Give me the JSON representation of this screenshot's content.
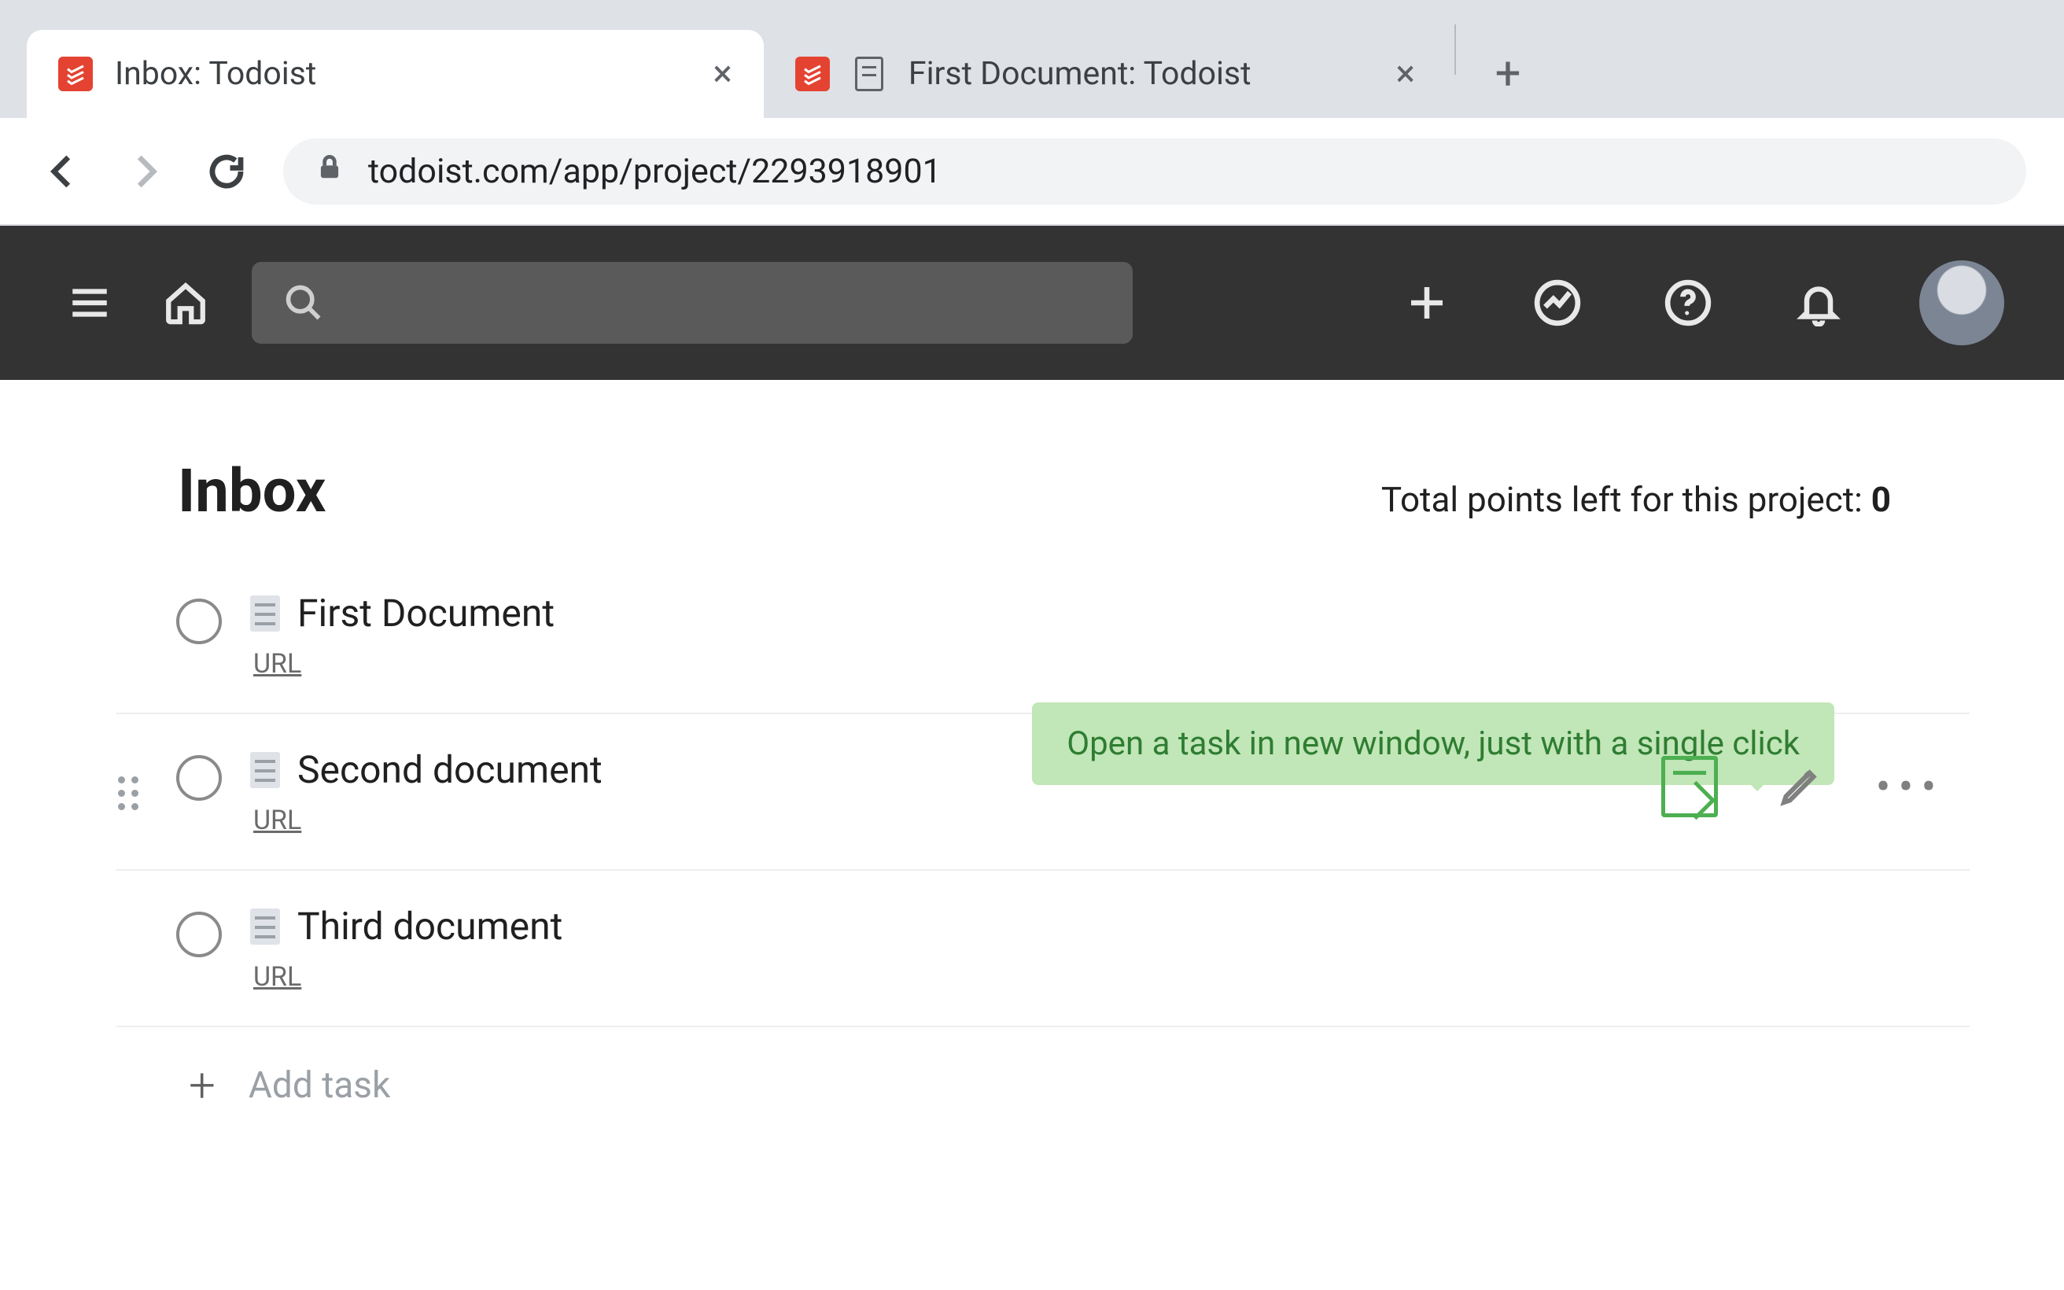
{
  "browser": {
    "tabs": [
      {
        "title": "Inbox: Todoist",
        "active": true
      },
      {
        "title": "First Document: Todoist",
        "active": false
      }
    ],
    "url": "todoist.com/app/project/2293918901"
  },
  "app_header": {
    "search_placeholder": ""
  },
  "project": {
    "title": "Inbox",
    "points_label": "Total points left for this project: ",
    "points_value": "0"
  },
  "tooltip": {
    "text": "Open a task in new window, just with a single click"
  },
  "tasks": [
    {
      "title": "First Document",
      "sub": "URL",
      "hover": false
    },
    {
      "title": "Second document",
      "sub": "URL",
      "hover": true
    },
    {
      "title": "Third document",
      "sub": "URL",
      "hover": false
    }
  ],
  "add_task_label": "Add task"
}
